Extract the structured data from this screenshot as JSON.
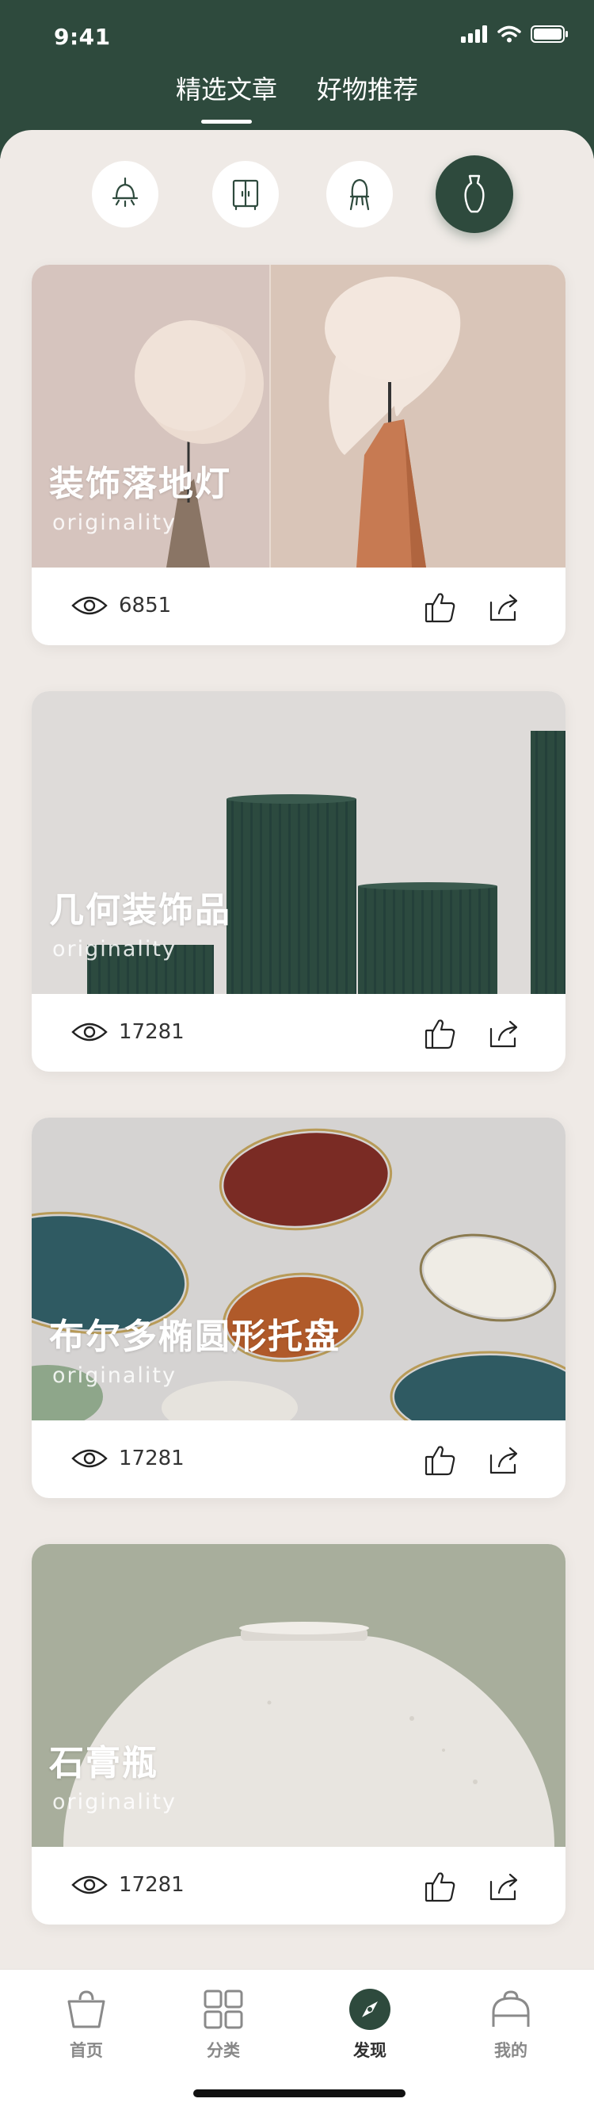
{
  "status": {
    "time": "9:41"
  },
  "top_tabs": [
    {
      "label": "精选文章",
      "active": true
    },
    {
      "label": "好物推荐",
      "active": false
    }
  ],
  "categories": [
    {
      "icon": "lamp-icon"
    },
    {
      "icon": "wardrobe-icon"
    },
    {
      "icon": "chair-icon"
    },
    {
      "icon": "vase-icon",
      "active": true
    }
  ],
  "cards": [
    {
      "title": "装饰落地灯",
      "subtitle": "originality",
      "views": "6851"
    },
    {
      "title": "几何装饰品",
      "subtitle": "originality",
      "views": "17281"
    },
    {
      "title": "布尔多椭圆形托盘",
      "subtitle": "originality",
      "views": "17281"
    },
    {
      "title": "石膏瓶",
      "subtitle": "originality",
      "views": "17281"
    }
  ],
  "bottom_nav": [
    {
      "label": "首页",
      "icon": "bag-icon"
    },
    {
      "label": "分类",
      "icon": "grid-icon"
    },
    {
      "label": "发现",
      "icon": "compass-icon",
      "active": true
    },
    {
      "label": "我的",
      "icon": "profile-icon"
    }
  ],
  "colors": {
    "brand": "#2e4a3d",
    "background": "#efeae6"
  }
}
